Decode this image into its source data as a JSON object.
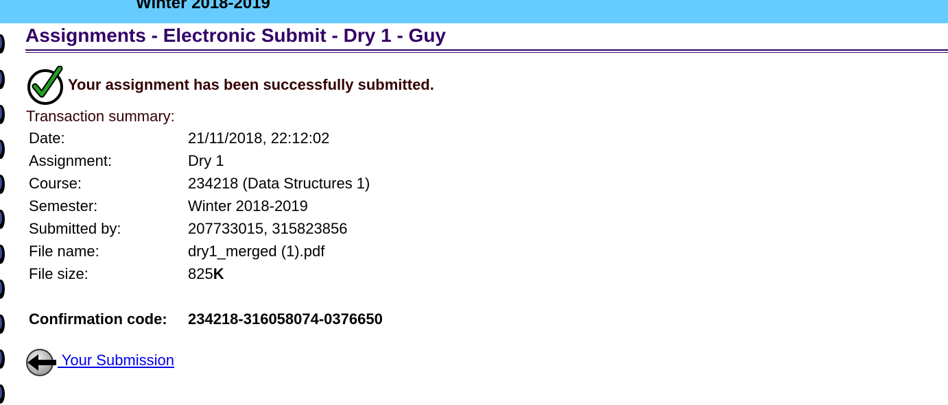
{
  "banner": {
    "semester_text": "Winter 2018-2019",
    "color": "#66ccff"
  },
  "header": {
    "title": "Assignments - Electronic Submit - Dry 1 - Guy",
    "title_color": "#330066"
  },
  "status": {
    "icon": "check-circle-icon",
    "message": "Your assignment has been successfully submitted."
  },
  "summary": {
    "label": "Transaction summary:",
    "rows": [
      {
        "key": "Date:",
        "value": "21/11/2018, 22:12:02"
      },
      {
        "key": "Assignment:",
        "value": "Dry 1"
      },
      {
        "key": "Course:",
        "value": "234218 (Data Structures 1)"
      },
      {
        "key": "Semester:",
        "value": "Winter 2018-2019"
      },
      {
        "key": "Submitted by:",
        "value": "207733015, 315823856"
      },
      {
        "key": "File name:",
        "value": "dry1_merged (1).pdf"
      }
    ],
    "file_size": {
      "key": "File size:",
      "value": "825",
      "unit": "K"
    },
    "confirmation": {
      "key": "Confirmation code:",
      "value": "234218-316058074-0376650"
    }
  },
  "navigation": {
    "back_icon": "back-arrow-icon",
    "back_label": " Your Submission",
    "link_color": "#0000ee"
  }
}
